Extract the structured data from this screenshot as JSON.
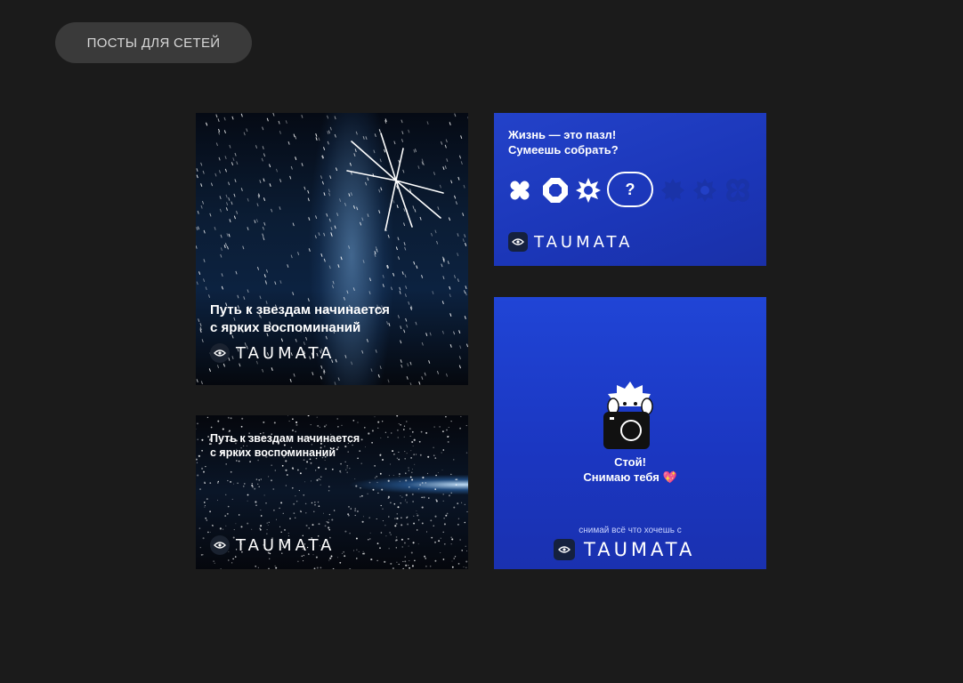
{
  "header": {
    "chip_label": "ПОСТЫ ДЛЯ СЕТЕЙ"
  },
  "brand": {
    "name": "TAUMATA"
  },
  "cards": {
    "stars_square": {
      "line1": "Путь к звездам начинается",
      "line2": "с ярких воспоминаний"
    },
    "stars_wide": {
      "line1": "Путь к звездам начинается",
      "line2": "с ярких воспоминаний"
    },
    "puzzle": {
      "line1": "Жизнь — это пазл!",
      "line2": "Сумеешь собрать?",
      "question": "?"
    },
    "camera": {
      "line1": "Стой!",
      "line2": "Снимаю тебя",
      "emoji": "💖",
      "tagline": "снимай всё что хочешь с"
    }
  },
  "colors": {
    "background": "#1b1b1b",
    "chip": "#3a3a3a",
    "blue": "#1f3fc8",
    "dark_navy": "#0b1d35"
  }
}
